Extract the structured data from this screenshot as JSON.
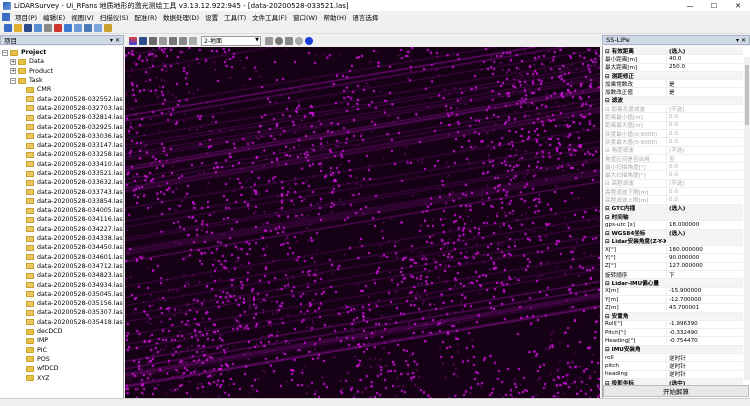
{
  "window": {
    "title": "LiDARSurvey - Ui_RFans 地质地形的激光测绘工具 v3.13.12.922:945 - [data-20200528-033521.las]",
    "minimize": "—",
    "maximize": "☐",
    "close": "✕"
  },
  "menu": [
    "项目(P)",
    "编辑(E)",
    "视图(V)",
    "扫描仪(S)",
    "配准(R)",
    "数据处理(D)",
    "设置",
    "工具(T)",
    "文件工具(F)",
    "窗口(W)",
    "帮助(H)",
    "语言选择"
  ],
  "toolbar2": {
    "view_select": "2-地面"
  },
  "colors": {
    "pointcloud": "#d41ae0",
    "background": "#160016"
  },
  "left_panel": {
    "header": "项目",
    "pin": "▾ ✕",
    "tree": {
      "root": "Project",
      "data": "Data",
      "product": "Product",
      "task": "Task",
      "cmr": "CMR",
      "files": [
        "data-20200528-032552.las",
        "data-20200528-032703.las",
        "data-20200528-032814.las",
        "data-20200528-032925.las",
        "data-20200528-033036.las",
        "data-20200528-033147.las",
        "data-20200528-033258.las",
        "data-20200528-033410.las",
        "data-20200528-033521.las",
        "data-20200528-033632.las",
        "data-20200528-033743.las",
        "data-20200528-033854.las",
        "data-20200528-034005.las",
        "data-20200528-034116.las",
        "data-20200528-034227.las",
        "data-20200528-034338.las",
        "data-20200528-034450.las",
        "data-20200528-034601.las",
        "data-20200528-034712.las",
        "data-20200528-034823.las",
        "data-20200528-034934.las",
        "data-20200528-035045.las",
        "data-20200528-035156.las",
        "data-20200528-035307.las",
        "data-20200528-035418.las"
      ],
      "folders": [
        "decDCD",
        "IMP",
        "PIC",
        "POS",
        "wfDCD",
        "XYZ"
      ]
    }
  },
  "right_panel": {
    "header": "SS-LiPe",
    "pin": "▾ ✕",
    "rows": [
      {
        "k": "⊟ 有效距离",
        "v": "(选入)",
        "cls": "cat"
      },
      {
        "k": "最小距离[m]",
        "v": "40.0",
        "cls": ""
      },
      {
        "k": "最大距离[m]",
        "v": "250.0",
        "cls": ""
      },
      {
        "k": "⊟ 测距修正",
        "v": "",
        "cls": "cat"
      },
      {
        "k": "加乘常数改",
        "v": "是",
        "cls": ""
      },
      {
        "k": "加数改正值",
        "v": "是",
        "cls": ""
      },
      {
        "k": "⊟ 滤波",
        "v": "",
        "cls": "cat"
      },
      {
        "k": "⊟ 距离灰度滤波",
        "v": "(不选)",
        "cls": "dim"
      },
      {
        "k": "距离最小值[m]",
        "v": "0.0",
        "cls": "dim"
      },
      {
        "k": "距离最大值[m]",
        "v": "0.0",
        "cls": "dim"
      },
      {
        "k": "灰度最小值(0-6000)",
        "v": "0.0",
        "cls": "dim"
      },
      {
        "k": "灰度最大值(0-6000)",
        "v": "0.0",
        "cls": "dim"
      },
      {
        "k": "⊟ 角度滤波",
        "v": "(不选)",
        "cls": "dim"
      },
      {
        "k": "角度区间是否启用",
        "v": "否",
        "cls": "dim"
      },
      {
        "k": "最小扫描角度[°]",
        "v": "0.0",
        "cls": "dim"
      },
      {
        "k": "最大扫描角度[°]",
        "v": "0.0",
        "cls": "dim"
      },
      {
        "k": "⊟ 高程滤波",
        "v": "(不选)",
        "cls": "dim"
      },
      {
        "k": "高程滤波下限[m]",
        "v": "0.0",
        "cls": "dim"
      },
      {
        "k": "高程滤波上限[m]",
        "v": "0.0",
        "cls": "dim"
      },
      {
        "k": "⊟ GTC内插",
        "v": "(选入)",
        "cls": "cat"
      },
      {
        "k": "⊟ 时间轴",
        "v": "",
        "cls": "cat"
      },
      {
        "k": "gps-utc [s]",
        "v": "18.000000",
        "cls": ""
      },
      {
        "k": "⊟ WGS84坐标",
        "v": "(选入)",
        "cls": "cat"
      },
      {
        "k": "⊟ Lidar安装角度(Z-Y-X)",
        "v": "",
        "cls": "cat"
      },
      {
        "k": "X[°]",
        "v": "180.000000",
        "cls": ""
      },
      {
        "k": "Y[°]",
        "v": "90.000000",
        "cls": ""
      },
      {
        "k": "Z[°]",
        "v": "127.000000",
        "cls": ""
      },
      {
        "k": "旋转顺序",
        "v": "下",
        "cls": ""
      },
      {
        "k": "⊟ Lidar-IMU偏心量",
        "v": "",
        "cls": "cat"
      },
      {
        "k": "X[m]",
        "v": "-15.900000",
        "cls": ""
      },
      {
        "k": "Y[m]",
        "v": "-12.700000",
        "cls": ""
      },
      {
        "k": "Z[m]",
        "v": "43.700001",
        "cls": ""
      },
      {
        "k": "⊟ 安置角",
        "v": "",
        "cls": "cat"
      },
      {
        "k": "Roll[°]",
        "v": "-1.996390",
        "cls": ""
      },
      {
        "k": "Pitch[°]",
        "v": "-0.332490",
        "cls": ""
      },
      {
        "k": "Heading[°]",
        "v": "-0.754470",
        "cls": ""
      },
      {
        "k": "⊟ IMU安装角",
        "v": "",
        "cls": "cat"
      },
      {
        "k": "roll",
        "v": "逆时针",
        "cls": ""
      },
      {
        "k": "pitch",
        "v": "逆时针",
        "cls": ""
      },
      {
        "k": "heading",
        "v": "逆时针",
        "cls": ""
      },
      {
        "k": "⊟ 投影坐标",
        "v": "(选中)",
        "cls": "cat"
      }
    ],
    "action_button": "开始解算"
  }
}
